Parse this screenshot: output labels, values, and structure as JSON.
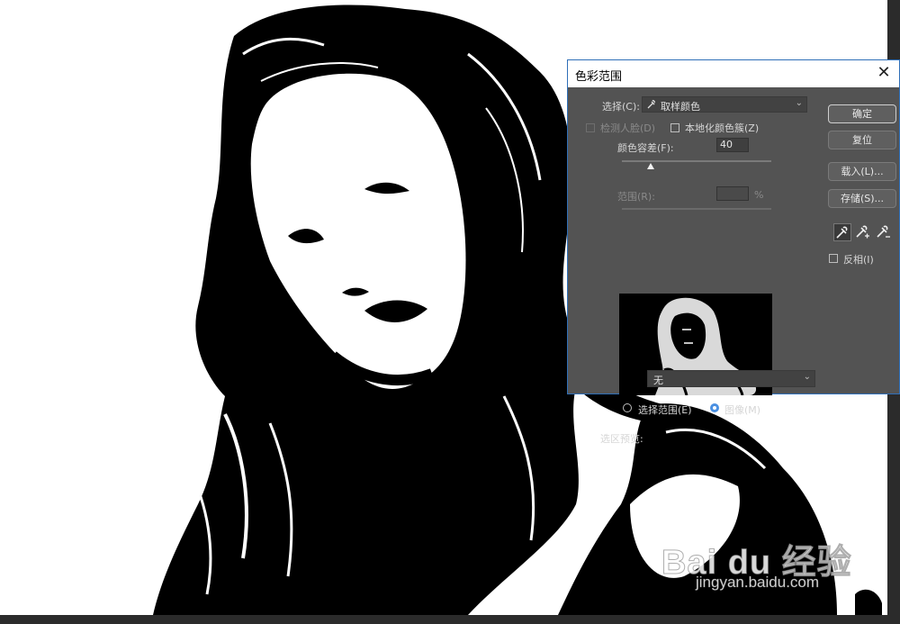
{
  "dialog": {
    "title": "色彩范围",
    "close_glyph": "✕",
    "select": {
      "label": "选择(C):",
      "value": "取样颜色",
      "icon": "eyedropper-icon"
    },
    "detect_faces": {
      "label": "检测人脸(D)",
      "checked": false,
      "enabled": false
    },
    "localized_clusters": {
      "label": "本地化颜色簇(Z)",
      "checked": false
    },
    "fuzziness": {
      "label": "颜色容差(F):",
      "value": "40"
    },
    "range": {
      "label": "范围(R):",
      "value": "",
      "unit": "%"
    },
    "buttons": {
      "ok": "确定",
      "reset": "复位",
      "load": "载入(L)...",
      "save": "存储(S)..."
    },
    "tools": [
      "eyedropper-icon",
      "eyedropper-plus-icon",
      "eyedropper-minus-icon"
    ],
    "invert": {
      "label": "反相(I)",
      "checked": false
    },
    "view": {
      "selection_label": "选择范围(E)",
      "image_label": "图像(M)",
      "selected": "image"
    },
    "selection_preview": {
      "label": "选区预览:",
      "value": "无"
    }
  },
  "watermark": {
    "main": "Bai du 经验",
    "sub": "jingyan.baidu.com"
  }
}
